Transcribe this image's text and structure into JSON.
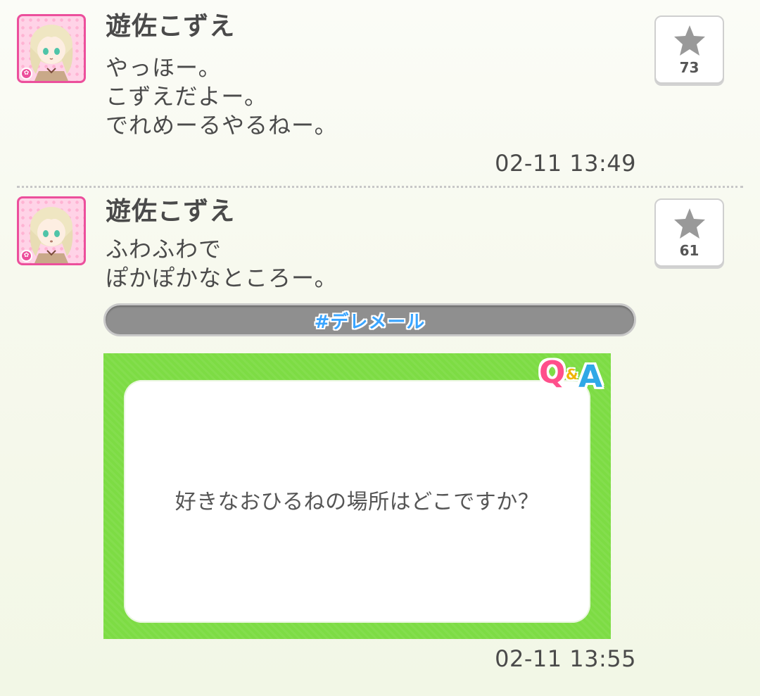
{
  "colors": {
    "avatar_frame": "#ec4f9c",
    "hashtag_text": "#3aa5ff",
    "qa_card_bg": "#7ddc44",
    "qa_q": "#ff4f8b",
    "qa_amp": "#f0b400",
    "qa_a": "#2fa8e6"
  },
  "icons": {
    "star": "star-icon",
    "avatar": "avatar-icon"
  },
  "posts": [
    {
      "author": "遊佐こずえ",
      "message_lines": [
        "やっほー。",
        "こずえだよー。",
        "でれめーるやるねー。"
      ],
      "star_count": "73",
      "timestamp": "02-11 13:49"
    },
    {
      "author": "遊佐こずえ",
      "message_lines": [
        "ふわふわで",
        "ぽかぽかなところー。"
      ],
      "star_count": "61",
      "hashtag": "#デレメール",
      "qa_card": {
        "logo_q": "Q",
        "logo_amp": "&",
        "logo_a": "A",
        "question": "好きなおひるねの場所はどこですか？"
      },
      "timestamp": "02-11 13:55"
    }
  ]
}
